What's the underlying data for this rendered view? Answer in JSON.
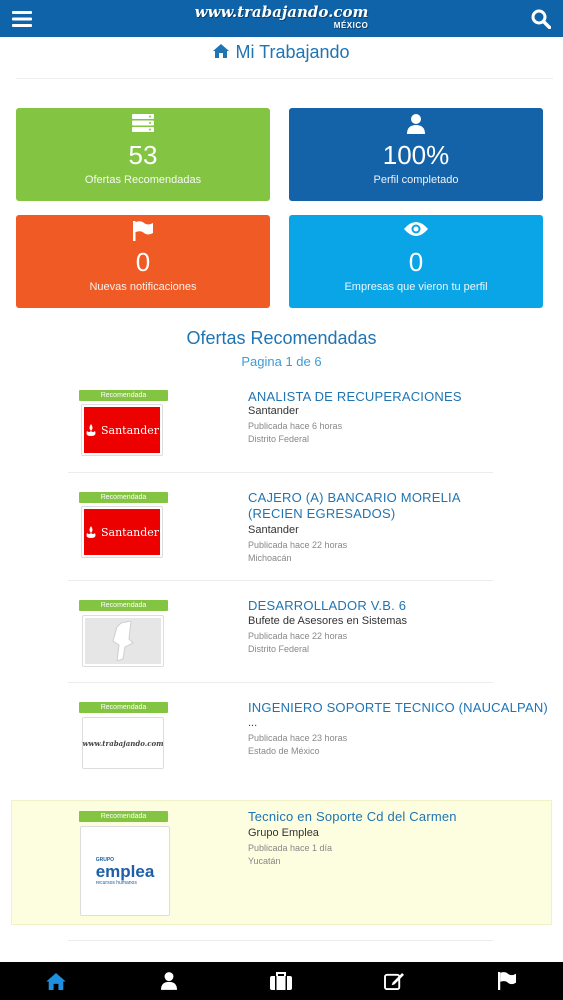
{
  "header": {
    "logo_text": "www.trabajando.com",
    "logo_sub": "MÉXICO",
    "menu_icon": "hamburger-menu-icon",
    "search_icon": "search-icon"
  },
  "page": {
    "title": "Mi Trabajando",
    "title_icon": "home-icon"
  },
  "tiles": [
    {
      "value": "53",
      "label": "Ofertas Recomendadas",
      "icon": "server-list-icon",
      "color": "#84c443"
    },
    {
      "value": "100%",
      "label": "Perfil completado",
      "icon": "user-icon",
      "color": "#1462a8"
    },
    {
      "value": "0",
      "label": "Nuevas notificaciones",
      "icon": "flag-icon",
      "color": "#f05a24"
    },
    {
      "value": "0",
      "label": "Empresas que vieron tu perfil",
      "icon": "eye-icon",
      "color": "#0aa5e6"
    }
  ],
  "offers": {
    "title": "Ofertas Recomendadas",
    "pager": "Pagina 1 de 6",
    "badge": "Recomendada",
    "items": [
      {
        "title": "ANALISTA DE RECUPERACIONES",
        "company": "Santander",
        "posted": "Publicada hace 6 horas",
        "location": "Distrito Federal",
        "logo": "Santander"
      },
      {
        "title": "CAJERO (A) BANCARIO MORELIA (RECIEN EGRESADOS)",
        "company": "Santander",
        "posted": "Publicada hace 22 horas",
        "location": "Michoacán",
        "logo": "Santander"
      },
      {
        "title": "DESARROLLADOR V.B. 6",
        "company": "Bufete de Asesores en Sistemas",
        "posted": "Publicada hace 22 horas",
        "location": "Distrito Federal",
        "logo": ""
      },
      {
        "title": "INGENIERO SOPORTE TECNICO (NAUCALPAN)",
        "company": "...",
        "posted": "Publicada hace 23 horas",
        "location": "Estado de México",
        "logo": "www.trabajando.com"
      },
      {
        "title": "Tecnico en Soporte Cd del Carmen",
        "company": "Grupo Emplea",
        "posted": "Publicada hace 1 día",
        "location": "Yucatán",
        "logo_small": "GRUPO",
        "logo_main": "emplea",
        "logo_tag": "recursos humanos"
      }
    ]
  },
  "bottom_nav": [
    {
      "icon": "home-icon",
      "active": true,
      "color": "#1f8fe0"
    },
    {
      "icon": "user-icon",
      "active": false
    },
    {
      "icon": "briefcase-icon",
      "active": false
    },
    {
      "icon": "edit-icon",
      "active": false
    },
    {
      "icon": "flag-icon",
      "active": false
    }
  ]
}
